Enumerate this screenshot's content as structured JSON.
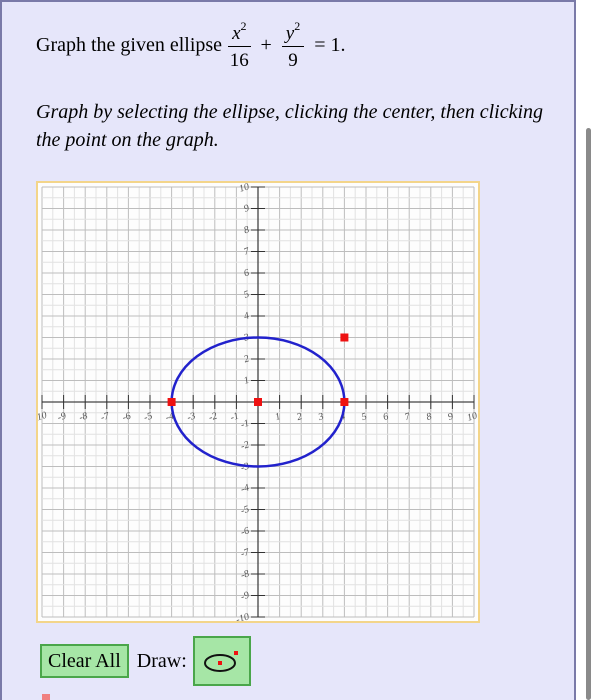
{
  "problem": {
    "prefix": "Graph the given ellipse",
    "x_num": "x",
    "x_exp": "2",
    "x_den": "16",
    "plus": "+",
    "y_num": "y",
    "y_exp": "2",
    "y_den": "9",
    "equals": "= 1."
  },
  "instructions": "Graph by selecting the ellipse, clicking the center, then clicking the point on the graph.",
  "graph": {
    "xlim": [
      -10,
      10
    ],
    "ylim": [
      -10,
      10
    ],
    "x_ticks": [
      "-10",
      "-9",
      "-8",
      "-7",
      "-6",
      "-5",
      "-4",
      "-3",
      "-2",
      "-1",
      "1",
      "2",
      "3",
      "4",
      "5",
      "6",
      "7",
      "8",
      "9",
      "10"
    ],
    "y_ticks": [
      "10",
      "9",
      "8",
      "7",
      "6",
      "5",
      "4",
      "3",
      "2",
      "1",
      "-1",
      "-2",
      "-3",
      "-4",
      "-5",
      "-6",
      "-7",
      "-8",
      "-9",
      "-10"
    ],
    "ellipse": {
      "center": [
        0,
        0
      ],
      "rx": 4,
      "ry": 3,
      "color": "#2222cc"
    },
    "points": [
      {
        "x": -4,
        "y": 0
      },
      {
        "x": 0,
        "y": 0
      },
      {
        "x": 4,
        "y": 0
      },
      {
        "x": 4,
        "y": 3
      }
    ],
    "point_color": "#ee1111"
  },
  "toolbar": {
    "clear_label": "Clear All",
    "draw_label": "Draw:",
    "draw_tool_icon": "ellipse-tool-icon"
  },
  "colors": {
    "panel_bg": "#e6e6fa",
    "button_bg": "#a6e6a6",
    "frame_border": "#f3d58a"
  }
}
